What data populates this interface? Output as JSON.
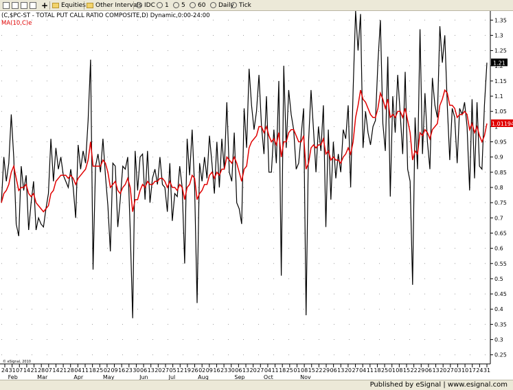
{
  "toolbar": {
    "equities_label": "Equities",
    "intervals_label": "Other Intervals",
    "idc_label": "IDC",
    "int_1": "1",
    "int_5": "5",
    "int_60": "60",
    "daily_label": "Daily",
    "tick_label": "Tick"
  },
  "footer": {
    "text": "Published by eSignal | www.esignal.com"
  },
  "chart_data": {
    "type": "line",
    "title": "(C,$PC-ST - TOTAL PUT CALL RATIO COMPOSITE,D) Dynamic,0:00-24:00",
    "ma_label": "MA(10,C)e",
    "copyright": "© eSignal, 2010",
    "y_ticks": [
      "0.25",
      "0.3",
      "0.35",
      "0.4",
      "0.45",
      "0.5",
      "0.55",
      "0.6",
      "0.65",
      "0.7",
      "0.75",
      "0.8",
      "0.85",
      "0.9",
      "0.95",
      "1",
      "1.05",
      "1.1",
      "1.15",
      "1.2",
      "1.25",
      "1.3",
      "1.35"
    ],
    "ylim": [
      0.22,
      1.38
    ],
    "last_value_label": "1.21",
    "ma_last_label": "1.01194",
    "colors": {
      "price": "#000000",
      "ma": "#e00000",
      "ma_badge": "#e00000",
      "grid": "#9a9a9a"
    },
    "x_day_labels": [
      "24",
      "31",
      "07",
      "14",
      "21",
      "28",
      "07",
      "14",
      "21",
      "28",
      "04",
      "11",
      "18",
      "25",
      "02",
      "09",
      "16",
      "23",
      "30",
      "06",
      "13",
      "20",
      "27",
      "05",
      "12",
      "19",
      "26",
      "02",
      "09",
      "16",
      "23",
      "30",
      "06",
      "13",
      "20",
      "27",
      "04",
      "11",
      "18",
      "25",
      "01",
      "08",
      "15",
      "22",
      "29",
      "06",
      "13",
      "20",
      "27",
      "04",
      "11",
      "18",
      "25",
      "01",
      "08",
      "15",
      "22",
      "29",
      "06",
      "13",
      "20",
      "27",
      "03",
      "10",
      "17",
      "24",
      "31"
    ],
    "x_month_labels": [
      {
        "label": "Feb",
        "day_index": 1
      },
      {
        "label": "Mar",
        "day_index": 5
      },
      {
        "label": "Apr",
        "day_index": 10
      },
      {
        "label": "May",
        "day_index": 14
      },
      {
        "label": "Jun",
        "day_index": 19
      },
      {
        "label": "Jul",
        "day_index": 23
      },
      {
        "label": "Aug",
        "day_index": 27
      },
      {
        "label": "Sep",
        "day_index": 32
      },
      {
        "label": "Oct",
        "day_index": 36
      },
      {
        "label": "Nov",
        "day_index": 41
      }
    ],
    "series": [
      {
        "values": [
          0.75,
          0.9,
          0.82,
          0.88,
          1.04,
          0.9,
          0.68,
          0.64,
          0.87,
          0.79,
          0.84,
          0.66,
          0.75,
          0.82,
          0.66,
          0.7,
          0.68,
          0.67,
          0.73,
          0.78,
          0.96,
          0.82,
          0.93,
          0.86,
          0.9,
          0.84,
          0.82,
          0.8,
          0.86,
          0.8,
          0.7,
          0.94,
          0.86,
          0.92,
          0.88,
          1.02,
          1.22,
          0.53,
          0.87,
          0.91,
          0.85,
          0.96,
          0.84,
          0.74,
          0.59,
          0.88,
          0.87,
          0.67,
          0.76,
          0.87,
          0.86,
          0.9,
          0.66,
          0.37,
          0.92,
          0.79,
          0.9,
          0.91,
          0.76,
          0.92,
          0.75,
          0.83,
          0.86,
          0.81,
          0.9,
          0.81,
          0.8,
          0.72,
          0.88,
          0.69,
          0.78,
          0.77,
          0.87,
          0.8,
          0.55,
          0.96,
          0.84,
          0.99,
          0.8,
          0.42,
          0.88,
          0.82,
          0.9,
          0.83,
          0.97,
          0.88,
          0.78,
          0.95,
          0.8,
          0.96,
          0.86,
          1.08,
          0.85,
          0.82,
          0.98,
          0.75,
          0.73,
          0.68,
          1.06,
          0.93,
          1.19,
          1.07,
          0.99,
          1.05,
          1.17,
          1.0,
          0.91,
          1.1,
          0.85,
          0.85,
          0.99,
          0.88,
          1.15,
          0.51,
          1.2,
          0.93,
          1.12,
          1.04,
          0.99,
          0.86,
          0.88,
          0.97,
          1.06,
          0.38,
          0.95,
          1.12,
          0.99,
          0.85,
          1.0,
          0.92,
          1.07,
          0.67,
          0.99,
          0.76,
          0.95,
          0.83,
          0.91,
          0.85,
          0.99,
          0.96,
          1.07,
          0.8,
          1.12,
          1.38,
          1.25,
          1.37,
          0.93,
          1.05,
          0.98,
          0.94,
          1.0,
          1.02,
          1.21,
          1.35,
          1.01,
          0.92,
          1.23,
          0.77,
          1.1,
          0.98,
          1.17,
          1.04,
          0.91,
          1.18,
          0.86,
          0.82,
          0.48,
          1.03,
          0.86,
          1.32,
          0.91,
          1.11,
          0.95,
          0.86,
          1.16,
          1.07,
          1.03,
          1.33,
          1.21,
          1.3,
          1.07,
          0.89,
          1.06,
          1.03,
          0.88,
          1.06,
          1.04,
          1.08,
          1.0,
          0.79,
          1.09,
          0.83,
          1.08,
          0.87,
          0.86,
          1.07,
          1.21
        ]
      },
      {
        "values": [
          0.75,
          0.78,
          0.79,
          0.81,
          0.85,
          0.87,
          0.83,
          0.79,
          0.8,
          0.8,
          0.81,
          0.78,
          0.77,
          0.78,
          0.75,
          0.74,
          0.73,
          0.72,
          0.73,
          0.74,
          0.78,
          0.79,
          0.82,
          0.83,
          0.84,
          0.84,
          0.84,
          0.83,
          0.84,
          0.83,
          0.81,
          0.83,
          0.84,
          0.85,
          0.86,
          0.89,
          0.95,
          0.87,
          0.87,
          0.87,
          0.87,
          0.89,
          0.88,
          0.85,
          0.8,
          0.81,
          0.82,
          0.79,
          0.78,
          0.8,
          0.81,
          0.83,
          0.8,
          0.72,
          0.76,
          0.76,
          0.79,
          0.81,
          0.8,
          0.82,
          0.81,
          0.81,
          0.82,
          0.82,
          0.83,
          0.83,
          0.82,
          0.8,
          0.82,
          0.8,
          0.8,
          0.79,
          0.81,
          0.8,
          0.76,
          0.8,
          0.81,
          0.84,
          0.83,
          0.76,
          0.78,
          0.79,
          0.81,
          0.81,
          0.84,
          0.85,
          0.83,
          0.85,
          0.84,
          0.86,
          0.86,
          0.9,
          0.89,
          0.88,
          0.9,
          0.88,
          0.85,
          0.82,
          0.86,
          0.87,
          0.93,
          0.95,
          0.96,
          0.97,
          1.0,
          1.0,
          0.98,
          1.0,
          0.97,
          0.95,
          0.96,
          0.94,
          0.98,
          0.9,
          0.95,
          0.95,
          0.98,
          0.99,
          0.99,
          0.97,
          0.95,
          0.95,
          0.97,
          0.86,
          0.88,
          0.93,
          0.94,
          0.93,
          0.94,
          0.94,
          0.96,
          0.91,
          0.92,
          0.89,
          0.9,
          0.89,
          0.89,
          0.88,
          0.9,
          0.91,
          0.93,
          0.91,
          0.95,
          1.03,
          1.07,
          1.12,
          1.09,
          1.08,
          1.06,
          1.04,
          1.03,
          1.03,
          1.06,
          1.11,
          1.09,
          1.06,
          1.09,
          1.03,
          1.04,
          1.03,
          1.05,
          1.05,
          1.03,
          1.06,
          1.02,
          0.98,
          0.89,
          0.92,
          0.91,
          0.98,
          0.97,
          0.99,
          0.98,
          0.96,
          0.99,
          1.0,
          1.01,
          1.07,
          1.09,
          1.12,
          1.11,
          1.07,
          1.07,
          1.06,
          1.03,
          1.04,
          1.04,
          1.05,
          1.04,
          0.99,
          1.01,
          0.98,
          1.0,
          0.97,
          0.95,
          0.97,
          1.01
        ]
      }
    ]
  }
}
